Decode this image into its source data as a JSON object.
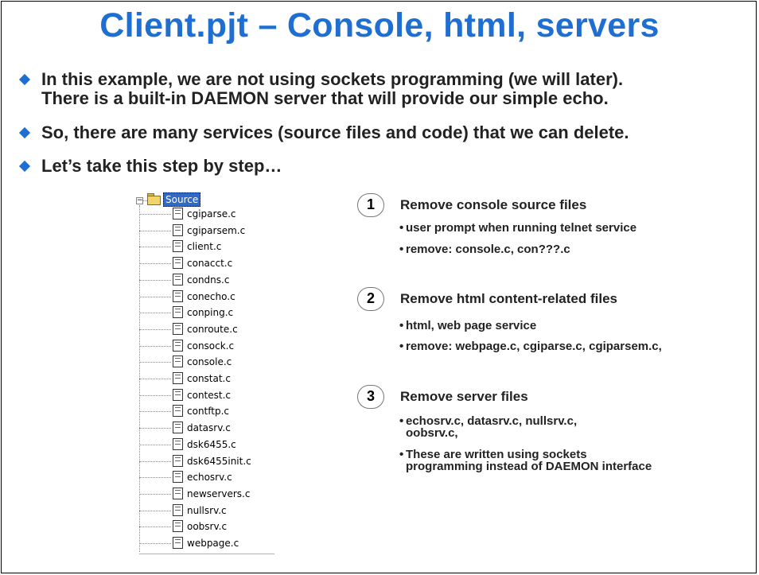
{
  "title": "Client.pjt – Console, html, servers",
  "bullets": [
    {
      "line1": "In this example, we are not using sockets programming (we will later).",
      "line2": "There is a built-in DAEMON server that will provide our simple echo."
    },
    {
      "line1": "So, there are many services (source files and code) that we can delete."
    },
    {
      "line1": "Let’s take this step by step…"
    }
  ],
  "tree": {
    "expander": "−",
    "root_label": "Source",
    "file_icon_glyph": "±",
    "files": [
      "cgiparse.c",
      "cgiparsem.c",
      "client.c",
      "conacct.c",
      "condns.c",
      "conecho.c",
      "conping.c",
      "conroute.c",
      "consock.c",
      "console.c",
      "constat.c",
      "contest.c",
      "contftp.c",
      "datasrv.c",
      "dsk6455.c",
      "dsk6455init.c",
      "echosrv.c",
      "newservers.c",
      "nullsrv.c",
      "oobsrv.c",
      "webpage.c"
    ]
  },
  "steps": [
    {
      "number": "1",
      "heading": "Remove console source files",
      "subs": [
        {
          "text": "user prompt when running telnet service"
        },
        {
          "text": "remove:  console.c, con???.c"
        }
      ]
    },
    {
      "number": "2",
      "heading": "Remove html content-related files",
      "subs": [
        {
          "text": "html, web page service"
        },
        {
          "text": "remove:  webpage.c, cgiparse.c, cgiparsem.c,"
        }
      ]
    },
    {
      "number": "3",
      "heading": "Remove server files",
      "subs": [
        {
          "line1": "echosrv.c, datasrv.c, nullsrv.c,",
          "line2": "oobsrv.c,"
        },
        {
          "line1": "These are written using sockets",
          "line2": "programming instead of DAEMON interface"
        }
      ]
    }
  ],
  "bullet_glyph": "•"
}
